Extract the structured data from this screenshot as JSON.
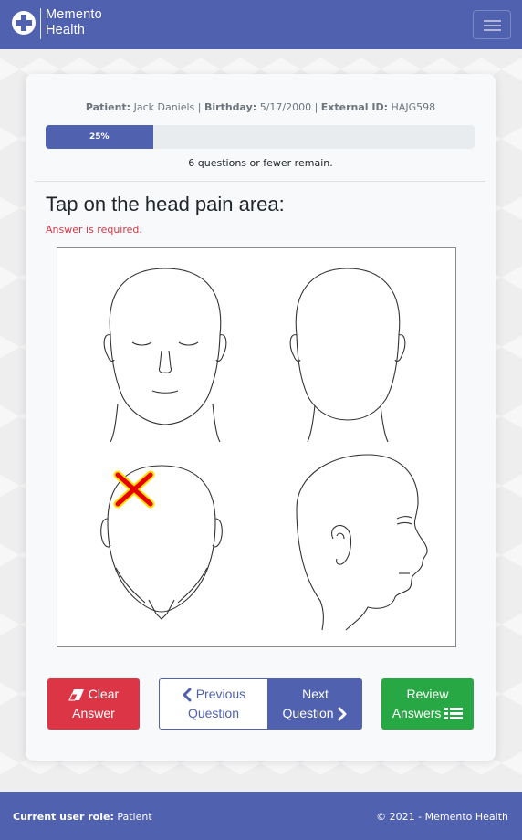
{
  "brand": {
    "line1": "Memento",
    "line2": "Health"
  },
  "patient": {
    "patient_label": "Patient:",
    "patient_name": "Jack Daniels",
    "birthday_label": "Birthday:",
    "birthday": "5/17/2000",
    "external_label": "External ID:",
    "external_id": "HAJG598"
  },
  "progress": {
    "label": "25%",
    "value": 25,
    "remaining_text": "6 questions or fewer remain."
  },
  "question": {
    "title": "Tap on the head pain area:",
    "error": "Answer is required.",
    "marker_icon": "x-mark-icon"
  },
  "buttons": {
    "clear_line1": "Clear",
    "clear_line2": "Answer",
    "prev_line1": "Previous",
    "prev_line2": "Question",
    "next_line1": "Next",
    "next_line2": "Question",
    "review_line1": "Review",
    "review_line2": "Answers"
  },
  "footer": {
    "role_label": "Current user role:",
    "role_value": "Patient",
    "copyright": "© 2021 - Memento Health"
  },
  "colors": {
    "primary": "#5061b0",
    "danger": "#dc3545",
    "success": "#28a745",
    "marker": "#e60000"
  }
}
